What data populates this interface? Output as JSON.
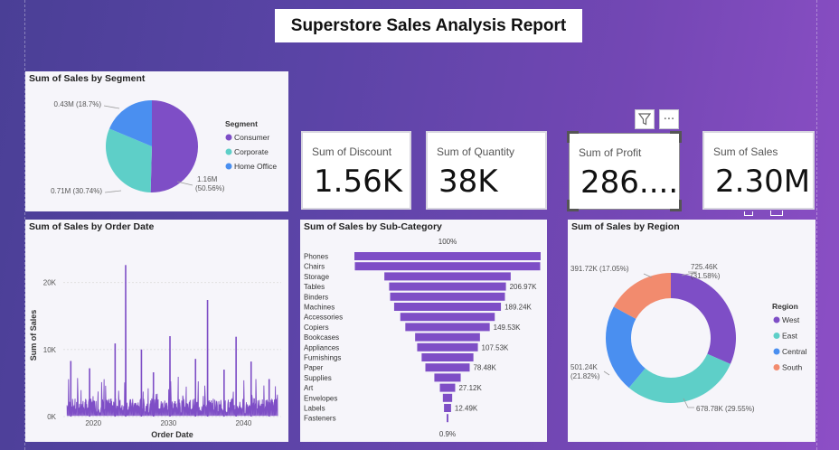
{
  "report_title": "Superstore Sales Analysis Report",
  "colors": {
    "purple": "#7e4ec6",
    "teal": "#5ecfc8",
    "blue": "#4a8ff0",
    "salmon": "#f28b6e"
  },
  "toolbar": {
    "filter_icon": "filter-icon",
    "more_icon": "more-options-icon",
    "more_label": "···"
  },
  "kpis": [
    {
      "label": "Sum of Discount",
      "value": "1.56K"
    },
    {
      "label": "Sum of Quantity",
      "value": "38K"
    },
    {
      "label": "Sum of Profit",
      "value": "286...."
    },
    {
      "label": "Sum of Sales",
      "value": "2.30M"
    }
  ],
  "segment": {
    "title": "Sum of Sales by Segment",
    "legend_title": "Segment",
    "chart_data": {
      "type": "pie",
      "title": "Sum of Sales by Segment",
      "labels": [
        "Consumer",
        "Corporate",
        "Home Office"
      ],
      "values": [
        1.16,
        0.71,
        0.43
      ],
      "value_labels": [
        "1.16M",
        "0.71M",
        "0.43M"
      ],
      "pct_labels": [
        "(50.56%)",
        "(30.74%)",
        "(18.7%)"
      ],
      "colors": [
        "#7e4ec6",
        "#5ecfc8",
        "#4a8ff0"
      ]
    }
  },
  "order_date": {
    "title": "Sum of Sales by Order Date",
    "chart_data": {
      "type": "line",
      "title": "Sum of Sales by Order Date",
      "xlabel": "Order Date",
      "ylabel": "Sum of Sales",
      "yticks": [
        "0K",
        "10K",
        "20K"
      ],
      "ylim": [
        0,
        24000
      ],
      "xticks": [
        "2020",
        "2030",
        "2040"
      ],
      "xlim": [
        2016,
        2045
      ],
      "peaks": [
        {
          "x": 2024.3,
          "y": 22600
        },
        {
          "x": 2022.9,
          "y": 10900
        },
        {
          "x": 2035.2,
          "y": 17400
        },
        {
          "x": 2030.2,
          "y": 12000
        },
        {
          "x": 2026.4,
          "y": 10000
        },
        {
          "x": 2039.0,
          "y": 11900
        },
        {
          "x": 2017.0,
          "y": 8300
        },
        {
          "x": 2041.0,
          "y": 8200
        },
        {
          "x": 2033.6,
          "y": 8600
        },
        {
          "x": 2028.0,
          "y": 6600
        },
        {
          "x": 2019.5,
          "y": 7200
        },
        {
          "x": 2037.4,
          "y": 7000
        },
        {
          "x": 2043.4,
          "y": 5600
        }
      ]
    }
  },
  "subcategory": {
    "title": "Sum of Sales by Sub-Category",
    "top_pct": "100%",
    "bottom_pct": "0.9%",
    "chart_data": {
      "type": "bar",
      "title": "Sum of Sales by Sub-Category",
      "categories": [
        "Phones",
        "Chairs",
        "Storage",
        "Tables",
        "Binders",
        "Machines",
        "Accessories",
        "Copiers",
        "Bookcases",
        "Appliances",
        "Furnishings",
        "Paper",
        "Supplies",
        "Art",
        "Envelopes",
        "Labels",
        "Fasteners"
      ],
      "values": [
        330007,
        328449,
        223844,
        206966,
        203413,
        189239,
        167380,
        149528,
        114880,
        107532,
        91705,
        78479,
        46674,
        27119,
        16476,
        12486,
        3024
      ],
      "data_labels": [
        "",
        "",
        "",
        "206.97K",
        "",
        "189.24K",
        "",
        "149.53K",
        "",
        "107.53K",
        "",
        "78.48K",
        "",
        "27.12K",
        "",
        "12.49K",
        ""
      ]
    }
  },
  "region": {
    "title": "Sum of Sales by Region",
    "legend_title": "Region",
    "chart_data": {
      "type": "pie",
      "title": "Sum of Sales by Region",
      "labels": [
        "West",
        "East",
        "Central",
        "South"
      ],
      "values": [
        725.46,
        678.78,
        501.24,
        391.72
      ],
      "value_labels": [
        "725.46K",
        "678.78K",
        "501.24K",
        "391.72K"
      ],
      "pct_labels": [
        "(31.58%)",
        "(29.55%)",
        "(21.82%)",
        "(17.05%)"
      ],
      "colors": [
        "#7e4ec6",
        "#5ecfc8",
        "#4a8ff0",
        "#f28b6e"
      ]
    }
  }
}
